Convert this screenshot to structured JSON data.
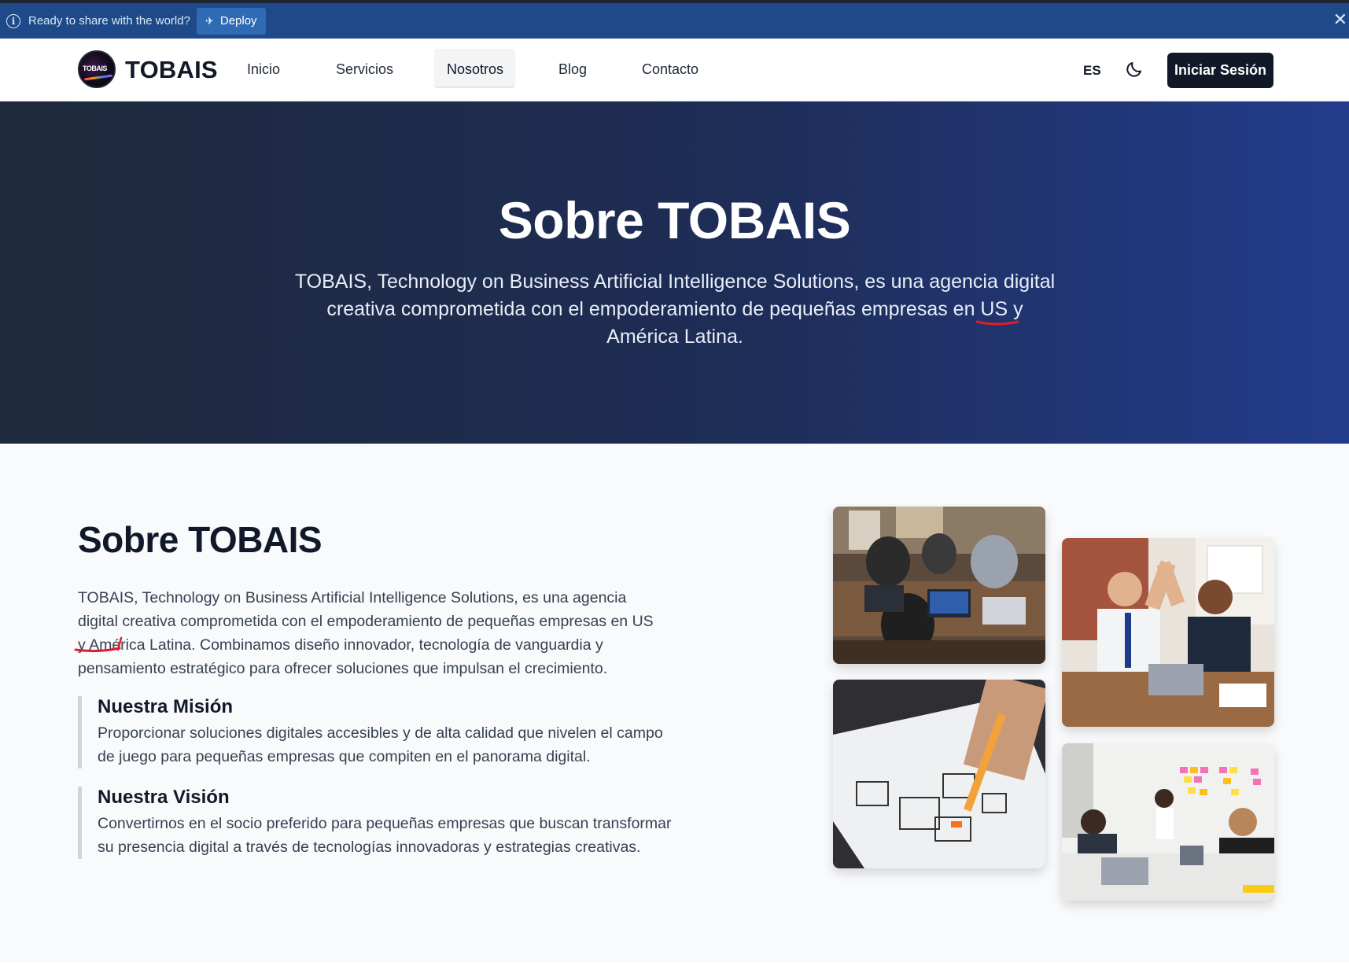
{
  "banner": {
    "text": "Ready to share with the world?",
    "deploy_label": "Deploy",
    "icons": [
      "info-icon",
      "rocket-icon",
      "close-icon"
    ]
  },
  "nav": {
    "brand": "TOBAIS",
    "links": [
      "Inicio",
      "Servicios",
      "Nosotros",
      "Blog",
      "Contacto"
    ],
    "active_link": "Nosotros",
    "language": "ES",
    "login_label": "Iniciar Sesión",
    "icons": [
      "logo",
      "moon-icon"
    ]
  },
  "hero": {
    "title": "Sobre TOBAIS",
    "subtitle": "TOBAIS, Technology on Business Artificial Intelligence Solutions, es una agencia digital creativa comprometida con el empoderamiento de pequeñas empresas en US y América Latina."
  },
  "about": {
    "title": "Sobre TOBAIS",
    "text": "TOBAIS, Technology on Business Artificial Intelligence Solutions, es una agencia digital creativa comprometida con el empoderamiento de pequeñas empresas en US y América Latina. Combinamos diseño innovador, tecnología de vanguardia y pensamiento estratégico para ofrecer soluciones que impulsan el crecimiento.",
    "mission": {
      "title": "Nuestra Misión",
      "text": "Proporcionar soluciones digitales accesibles y de alta calidad que nivelen el campo de juego para pequeñas empresas que compiten en el panorama digital."
    },
    "vision": {
      "title": "Nuestra Visión",
      "text": "Convertirnos en el socio preferido para pequeñas empresas que buscan transformar su presencia digital a través de tecnologías innovadoras y estrategias creativas."
    }
  },
  "colors": {
    "banner_bg": "#1e4a8a",
    "hero_start": "#1e293b",
    "hero_end": "#233c8c",
    "button_dark": "#111827",
    "annotation_red": "#e11d2d"
  }
}
